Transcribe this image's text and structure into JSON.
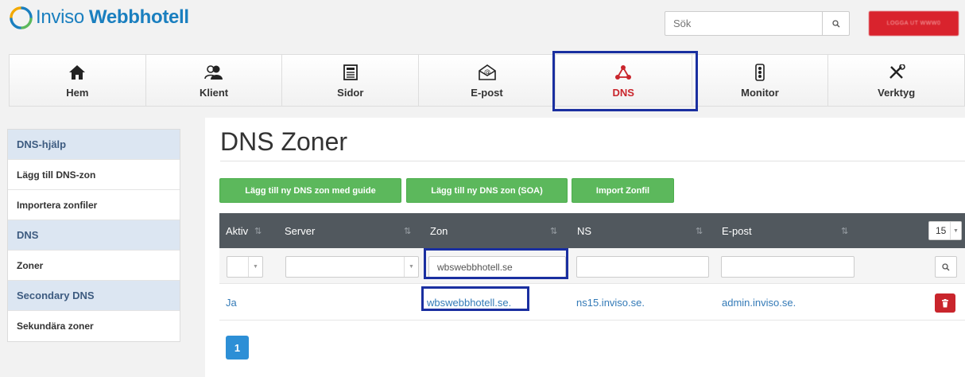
{
  "header": {
    "logo_word1": "Inviso",
    "logo_word2": "Webbhotell",
    "search_placeholder": "Sök",
    "logout_label": "LOGGA UT WWW0"
  },
  "nav": {
    "items": [
      {
        "label": "Hem",
        "icon": "home-icon"
      },
      {
        "label": "Klient",
        "icon": "users-icon"
      },
      {
        "label": "Sidor",
        "icon": "page-icon"
      },
      {
        "label": "E-post",
        "icon": "email-icon"
      },
      {
        "label": "DNS",
        "icon": "dns-icon",
        "active": true
      },
      {
        "label": "Monitor",
        "icon": "traffic-light-icon"
      },
      {
        "label": "Verktyg",
        "icon": "tools-icon"
      }
    ]
  },
  "sidebar": {
    "sections": [
      {
        "heading": "DNS-hjälp",
        "items": [
          "Lägg till DNS-zon",
          "Importera zonfiler"
        ]
      },
      {
        "heading": "DNS",
        "items": [
          "Zoner"
        ]
      },
      {
        "heading": "Secondary DNS",
        "items": [
          "Sekundära zoner"
        ]
      }
    ]
  },
  "main": {
    "title": "DNS Zoner",
    "buttons": [
      "Lägg till ny DNS zon med guide",
      "Lägg till ny DNS zon (SOA)",
      "Import Zonfil"
    ],
    "table": {
      "columns": [
        "Aktiv",
        "Server",
        "Zon",
        "NS",
        "E-post"
      ],
      "page_size": "15",
      "filters": {
        "zon": "wbswebbhotell.se"
      },
      "rows": [
        {
          "aktiv": "Ja",
          "server": "",
          "zon": "wbswebbhotell.se.",
          "ns": "ns15.inviso.se.",
          "epost": "admin.inviso.se."
        }
      ]
    },
    "pagination": {
      "current": "1"
    }
  },
  "colors": {
    "brand": "#1a7fbf",
    "nav_active": "#c9252c",
    "highlight_box": "#1a2fa0",
    "green_button": "#5cb85c",
    "table_header": "#51585e",
    "link": "#337ab7"
  }
}
